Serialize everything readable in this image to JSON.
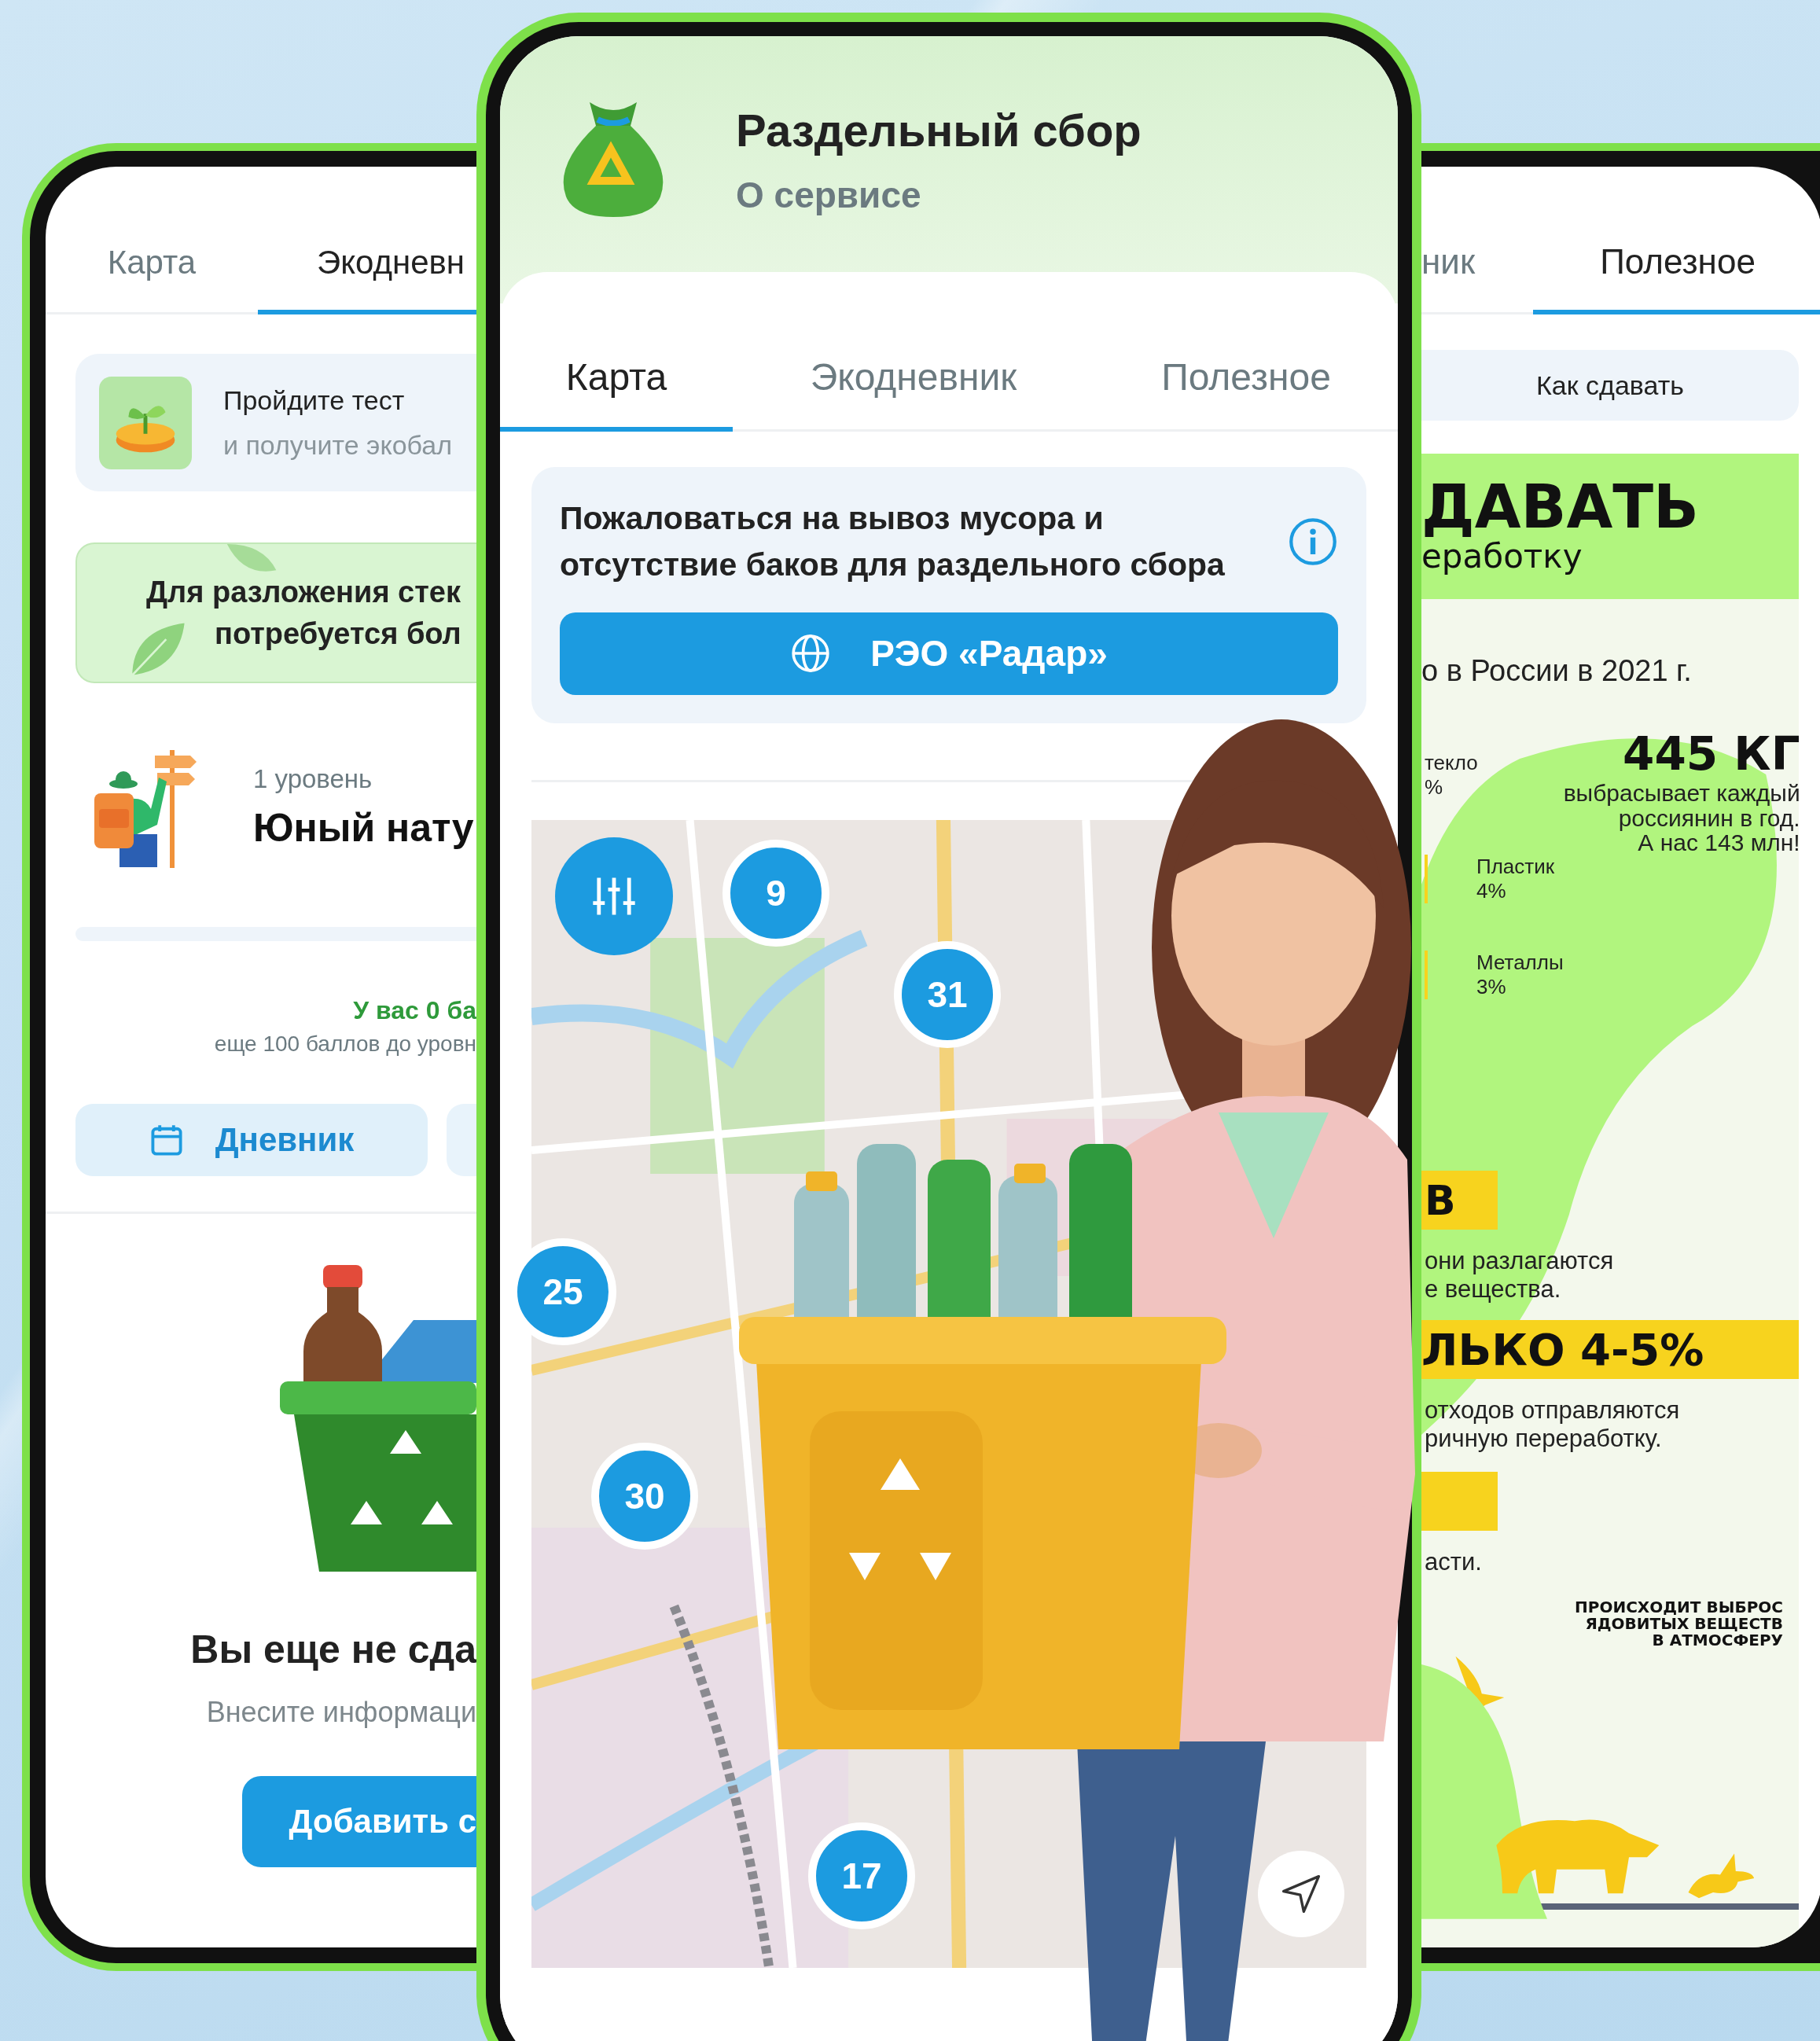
{
  "left_phone": {
    "tabs": [
      {
        "label": "Карта",
        "selected": false
      },
      {
        "label": "Экодневн",
        "selected": true
      }
    ],
    "quiz_card": {
      "title": "Пройдите тест",
      "subtitle": "и получите экобал"
    },
    "fact_banner": {
      "lines": [
        "Для разложения стек",
        "потребуется бол"
      ]
    },
    "progress": {
      "level_name": "1 уровень",
      "title": "Юный нату",
      "level": 0
    },
    "points": {
      "balance": "У вас 0 ба",
      "remaining": "еще 100 баллов до уровн"
    },
    "buttons": [
      {
        "kind": "diary",
        "label": "Дневник"
      },
      {
        "kind": "blank"
      }
    ],
    "empty_state": {
      "title": "Вы еще не сда",
      "text": "Внесите информаци",
      "button": "Добавить с"
    }
  },
  "center_phone": {
    "title": "Раздельный сбор",
    "subtitle": "О сервисе",
    "tabs": [
      {
        "label": "Карта",
        "selected": true
      },
      {
        "label": "Экодневник",
        "selected": false
      },
      {
        "label": "Полезное",
        "selected": false
      }
    ],
    "complaint": {
      "text": "Пожаловаться на вывоз мусора и отсутствие баков для раздельного сбора",
      "button": "РЭО «Радар»"
    },
    "map": {
      "clusters": [
        "9",
        "31",
        "25",
        "30",
        "17"
      ]
    }
  },
  "right_phone": {
    "tabs": [
      {
        "label": "ник",
        "selected": false
      },
      {
        "label": "Полезное",
        "selected": true
      }
    ],
    "section_button": "Как сдавать",
    "infographic": {
      "heading": "ДАВАТЬ",
      "subheading": "еработку",
      "intro": "о в России в 2021 г.",
      "stat": {
        "value": "445 КГ",
        "lines": [
          "выбрасывает каждый",
          "россиянин в год.",
          "А нас 143 млн!"
        ]
      },
      "shares": [
        {
          "label": "текло",
          "value": "%"
        },
        {
          "label": "Пластик",
          "value": "4%"
        },
        {
          "label": "Металлы",
          "value": "3%"
        }
      ],
      "blocks": [
        {
          "kind": "badge",
          "text": "В"
        },
        {
          "kind": "text",
          "lines": [
            "они разлагаются",
            "е вещества."
          ]
        },
        {
          "kind": "band",
          "text": "ЛЬКО 4-5%"
        },
        {
          "kind": "text",
          "lines": [
            "отходов отправляются",
            "ричную переработку."
          ]
        },
        {
          "kind": "badge"
        },
        {
          "kind": "text",
          "lines": [
            "асти."
          ]
        },
        {
          "kind": "caption",
          "lines": [
            "ПРОИСХОДИТ ВЫБРОС",
            "ЯДОВИТЫХ ВЕЩЕСТВ",
            "В АТМОСФЕРУ"
          ]
        }
      ]
    }
  }
}
